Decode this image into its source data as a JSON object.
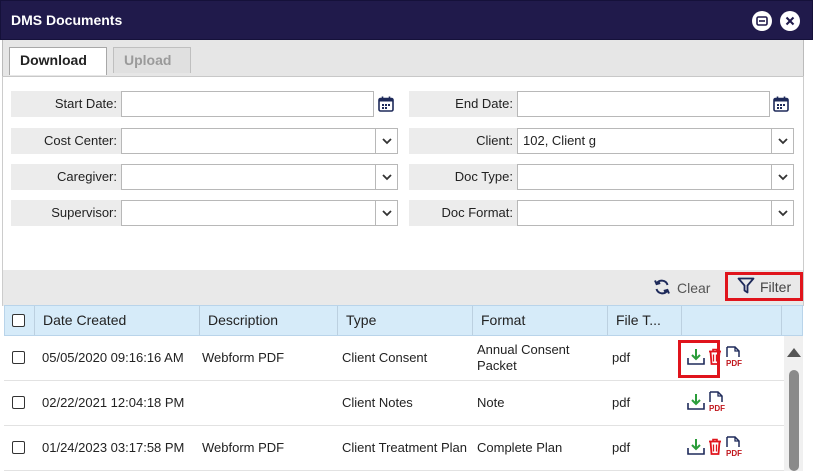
{
  "window": {
    "title": "DMS Documents"
  },
  "tabs": [
    {
      "label": "Download",
      "active": true
    },
    {
      "label": "Upload",
      "active": false
    }
  ],
  "filters": {
    "start_date": {
      "label": "Start Date:",
      "value": ""
    },
    "end_date": {
      "label": "End Date:",
      "value": ""
    },
    "cost_center": {
      "label": "Cost Center:",
      "value": ""
    },
    "client": {
      "label": "Client:",
      "value": "102, Client g"
    },
    "caregiver": {
      "label": "Caregiver:",
      "value": ""
    },
    "doc_type": {
      "label": "Doc Type:",
      "value": ""
    },
    "supervisor": {
      "label": "Supervisor:",
      "value": ""
    },
    "doc_format": {
      "label": "Doc Format:",
      "value": ""
    }
  },
  "toolbar": {
    "clear_label": "Clear",
    "filter_label": "Filter"
  },
  "grid": {
    "columns": [
      "Date Created",
      "Description",
      "Type",
      "Format",
      "File T..."
    ],
    "rows": [
      {
        "date": "05/05/2020 09:16:16 AM",
        "description": "Webform PDF",
        "type": "Client Consent",
        "format": "Annual Consent Packet",
        "file_type": "pdf",
        "actions": [
          "download-icon",
          "delete-icon",
          "pdf-icon"
        ]
      },
      {
        "date": "02/22/2021 12:04:18 PM",
        "description": "",
        "type": "Client Notes",
        "format": "Note",
        "file_type": "pdf",
        "actions": [
          "download-icon",
          "pdf-icon"
        ]
      },
      {
        "date": "01/24/2023 03:17:58 PM",
        "description": "Webform PDF",
        "type": "Client Treatment Plan",
        "format": "Complete Plan",
        "file_type": "pdf",
        "actions": [
          "download-icon",
          "delete-icon",
          "pdf-icon"
        ]
      }
    ]
  },
  "colors": {
    "titlebar": "#201a4b",
    "header": "#d6ebf9",
    "highlight": "#e0141c",
    "download_icon": "#2a9d3a",
    "delete_icon": "#e0141c",
    "pdf_icon": "#c0161c"
  }
}
